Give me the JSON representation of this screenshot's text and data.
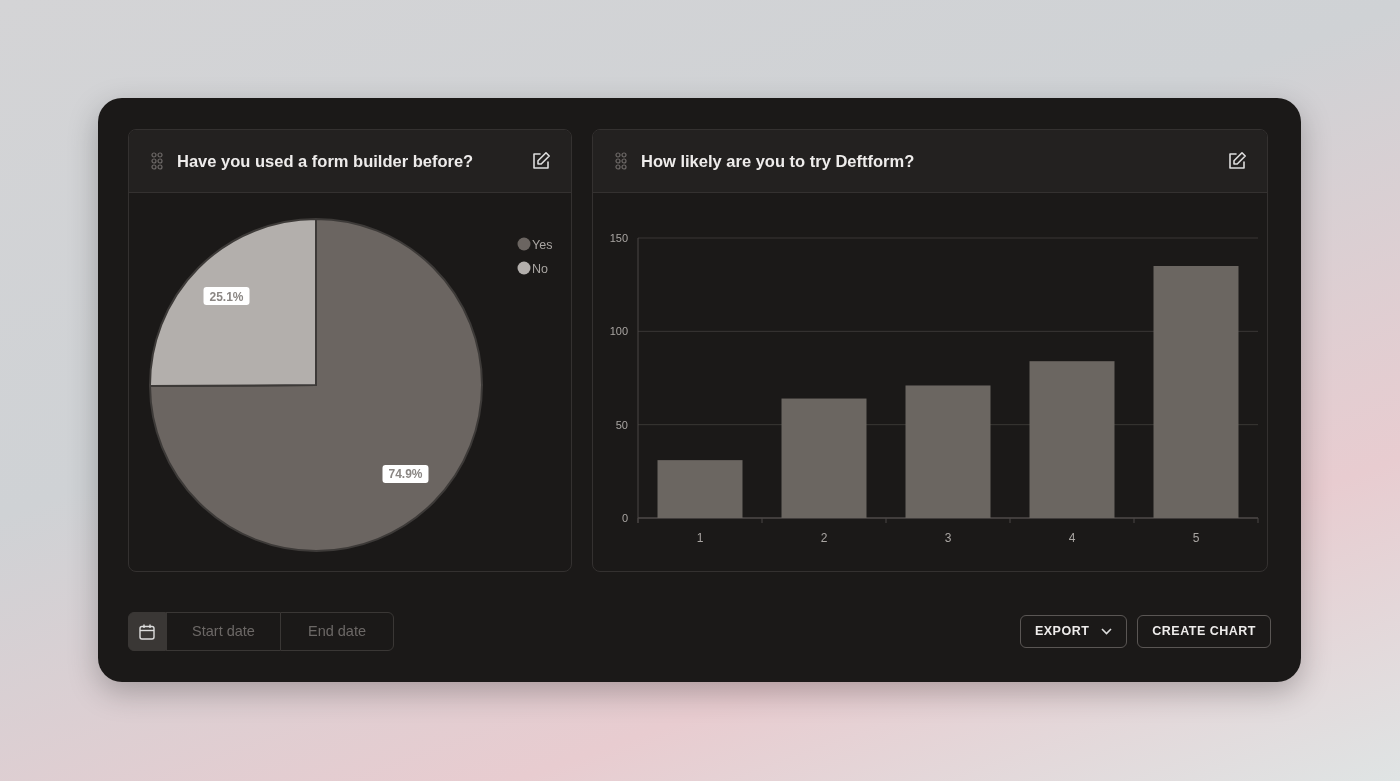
{
  "cards": [
    {
      "title": "Have you used a form builder before?",
      "chart_data": {
        "type": "pie",
        "categories": [
          "Yes",
          "No"
        ],
        "colors": [
          "#6b6561",
          "#b3afac"
        ],
        "values": [
          74.9,
          25.1
        ],
        "value_labels": [
          "74.9%",
          "25.1%"
        ],
        "legend": true
      }
    },
    {
      "title": "How likely are you to try Deftform?",
      "chart_data": {
        "type": "bar",
        "categories": [
          "1",
          "2",
          "3",
          "4",
          "5"
        ],
        "series": [
          {
            "color": "#6b6661",
            "values": [
              31,
              64,
              71,
              84,
              135
            ]
          }
        ],
        "ylim": [
          0,
          150
        ],
        "yticks": [
          0,
          50,
          100,
          150
        ]
      }
    }
  ],
  "date_range": {
    "start_placeholder": "Start date",
    "end_placeholder": "End date"
  },
  "buttons": [
    {
      "label": "EXPORT",
      "kind": "dropdown"
    },
    {
      "label": "CREATE CHART",
      "kind": "plain"
    }
  ]
}
